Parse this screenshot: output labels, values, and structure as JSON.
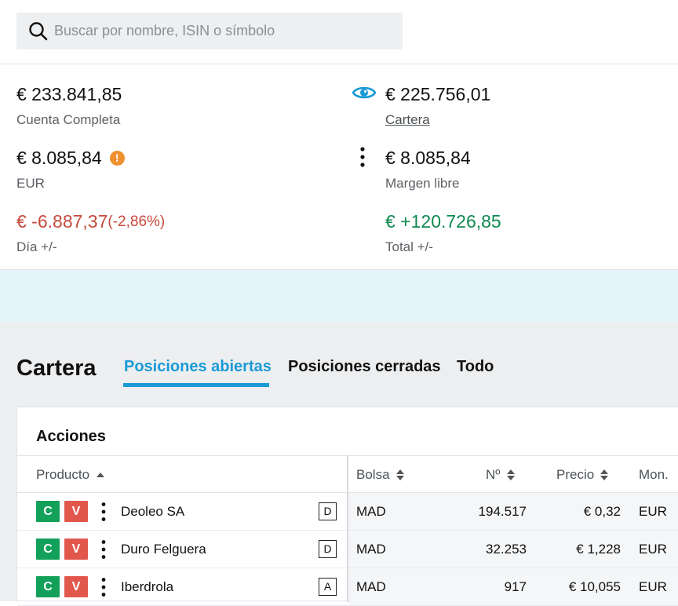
{
  "search": {
    "placeholder": "Buscar por nombre, ISIN o símbolo"
  },
  "summary": {
    "account_total": {
      "value": "€ 233.841,85",
      "label": "Cuenta Completa"
    },
    "portfolio": {
      "value": "€ 225.756,01",
      "label": "Cartera"
    },
    "cash": {
      "value": "€ 8.085,84",
      "label": "EUR"
    },
    "free_margin": {
      "value": "€ 8.085,84",
      "label": "Margen libre"
    },
    "day_change": {
      "value": "€ -6.887,37",
      "pct": "(-2,86%)",
      "label": "Día +/-"
    },
    "total_change": {
      "value": "€ +120.726,85",
      "label": "Total +/-"
    }
  },
  "colors": {
    "accent": "#1a9ad6",
    "buy": "#12a05a",
    "sell": "#e2574c",
    "negative": "#c84a3c",
    "positive": "#0f8a50",
    "warning": "#f0912f"
  },
  "portfolio": {
    "title": "Cartera",
    "tabs": [
      {
        "label": "Posiciones abiertas",
        "active": true
      },
      {
        "label": "Posiciones cerradas",
        "active": false
      },
      {
        "label": "Todo",
        "active": false
      }
    ],
    "section": "Acciones",
    "columns": {
      "product": "Producto",
      "exchange": "Bolsa",
      "qty": "Nº",
      "price": "Precio",
      "currency": "Mon."
    },
    "buy_label": "C",
    "sell_label": "V",
    "rows": [
      {
        "name": "Deoleo SA",
        "tag": "D",
        "exchange": "MAD",
        "qty": "194.517",
        "price": "€ 0,32",
        "currency": "EUR"
      },
      {
        "name": "Duro Felguera",
        "tag": "D",
        "exchange": "MAD",
        "qty": "32.253",
        "price": "€ 1,228",
        "currency": "EUR"
      },
      {
        "name": "Iberdrola",
        "tag": "A",
        "exchange": "MAD",
        "qty": "917",
        "price": "€ 10,055",
        "currency": "EUR"
      }
    ]
  }
}
